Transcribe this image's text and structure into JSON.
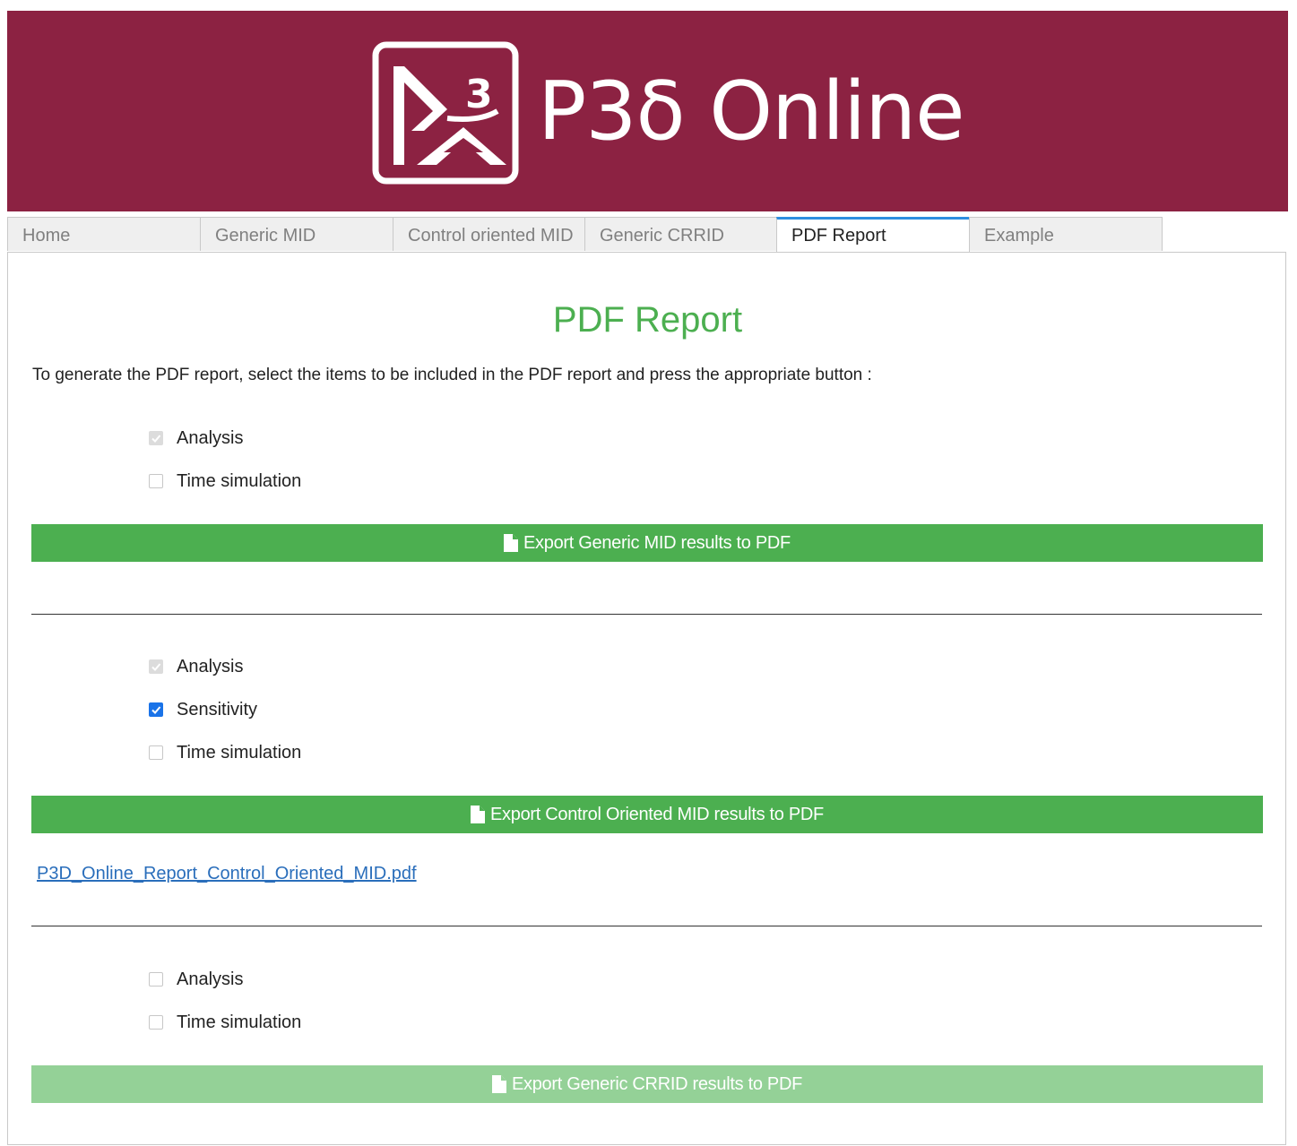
{
  "header": {
    "logo_text": "P3δ Online",
    "logo_icon": "p3d-logo-icon",
    "background_color": "#8c2242"
  },
  "tabs": [
    {
      "label": "Home",
      "active": false
    },
    {
      "label": "Generic MID",
      "active": false
    },
    {
      "label": "Control oriented MID",
      "active": false
    },
    {
      "label": "Generic CRRID",
      "active": false
    },
    {
      "label": "PDF Report",
      "active": true
    },
    {
      "label": "Example",
      "active": false
    }
  ],
  "main": {
    "title": "PDF Report",
    "intro": "To generate the PDF report, select the items to be included in the PDF report and press the appropriate button :",
    "generic_mid": {
      "options": [
        {
          "label": "Analysis",
          "checked": true,
          "disabled": true
        },
        {
          "label": "Time simulation",
          "checked": false,
          "disabled": false
        }
      ],
      "button_label": "Export Generic MID results to PDF",
      "button_icon": "file-icon"
    },
    "control_oriented_mid": {
      "options": [
        {
          "label": "Analysis",
          "checked": true,
          "disabled": true
        },
        {
          "label": "Sensitivity",
          "checked": true,
          "disabled": false
        },
        {
          "label": "Time simulation",
          "checked": false,
          "disabled": false
        }
      ],
      "button_label": "Export Control Oriented MID results to PDF",
      "button_icon": "file-icon",
      "download_link": "P3D_Online_Report_Control_Oriented_MID.pdf"
    },
    "generic_crrid": {
      "options": [
        {
          "label": "Analysis",
          "checked": false,
          "disabled": false
        },
        {
          "label": "Time simulation",
          "checked": false,
          "disabled": false
        }
      ],
      "button_label": "Export Generic CRRID results to PDF",
      "button_icon": "file-icon",
      "button_disabled": true
    }
  },
  "colors": {
    "accent_green": "#4caf50",
    "disabled_green": "#94d197",
    "active_tab_border": "#2e8ee0",
    "link": "#2a6ebb"
  }
}
